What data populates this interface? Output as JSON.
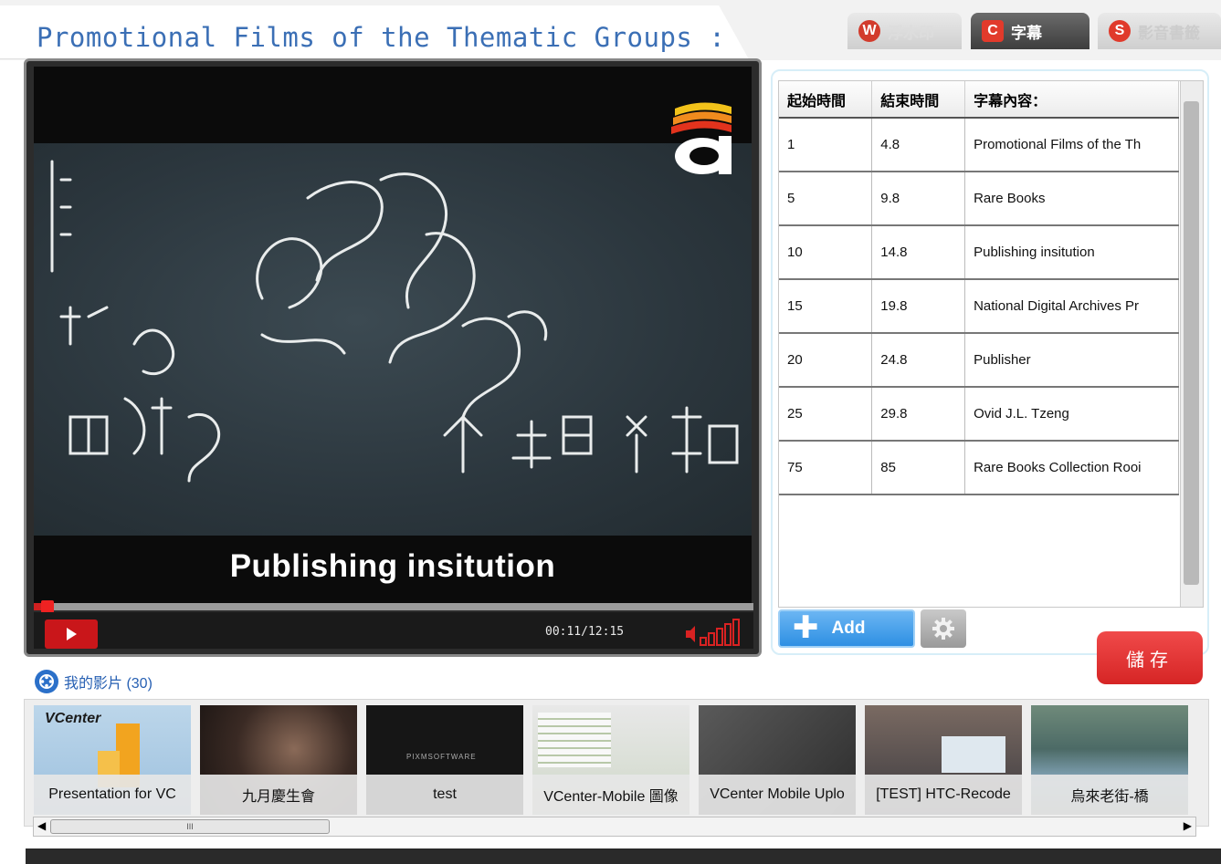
{
  "header": {
    "title": "Promotional Films of the Thematic Groups : Ra",
    "tabs": [
      {
        "badge": "W",
        "label": "浮水印"
      },
      {
        "badge": "C",
        "label": "字幕"
      },
      {
        "badge": "S",
        "label": "影音書籤"
      }
    ]
  },
  "player": {
    "subtitle_overlay": "Publishing insitution",
    "time_current": "00:11",
    "time_total": "12:15",
    "time_separator": "/",
    "progress_fraction": 0.015
  },
  "subtitle_table": {
    "headers": [
      "起始時間",
      "結束時間",
      "字幕內容："
    ],
    "rows": [
      {
        "start": "1",
        "end": "4.8",
        "text": "Promotional Films of the Th"
      },
      {
        "start": "5",
        "end": "9.8",
        "text": "Rare Books"
      },
      {
        "start": "10",
        "end": "14.8",
        "text": "Publishing insitution"
      },
      {
        "start": "15",
        "end": "19.8",
        "text": "National Digital Archives Pr"
      },
      {
        "start": "20",
        "end": "24.8",
        "text": "Publisher"
      },
      {
        "start": "25",
        "end": "29.8",
        "text": "Ovid J.L. Tzeng"
      },
      {
        "start": "75",
        "end": "85",
        "text": "Rare Books Collection Rooi"
      }
    ]
  },
  "actions": {
    "add_label": "Add",
    "save_label": "儲存"
  },
  "my_videos": {
    "label": "我的影片 (30)",
    "items": [
      {
        "title": "Presentation for VC",
        "overlay": "VCenter"
      },
      {
        "title": "九月慶生會"
      },
      {
        "title": "test",
        "overlay": "PIXMSOFTWARE"
      },
      {
        "title": "VCenter-Mobile 圖像"
      },
      {
        "title": "VCenter Mobile Uplo"
      },
      {
        "title": "[TEST] HTC-Recode"
      },
      {
        "title": "烏來老街-橋"
      }
    ],
    "scroll_thumb_label": "III"
  },
  "colors": {
    "title_blue": "#3b6fb5",
    "accent_red": "#d62525",
    "add_blue": "#2e8fe3"
  },
  "icons": {
    "play": "play-icon",
    "volume": "volume-icon",
    "gear": "gear-icon",
    "film": "film-icon",
    "plus": "plus-icon"
  }
}
